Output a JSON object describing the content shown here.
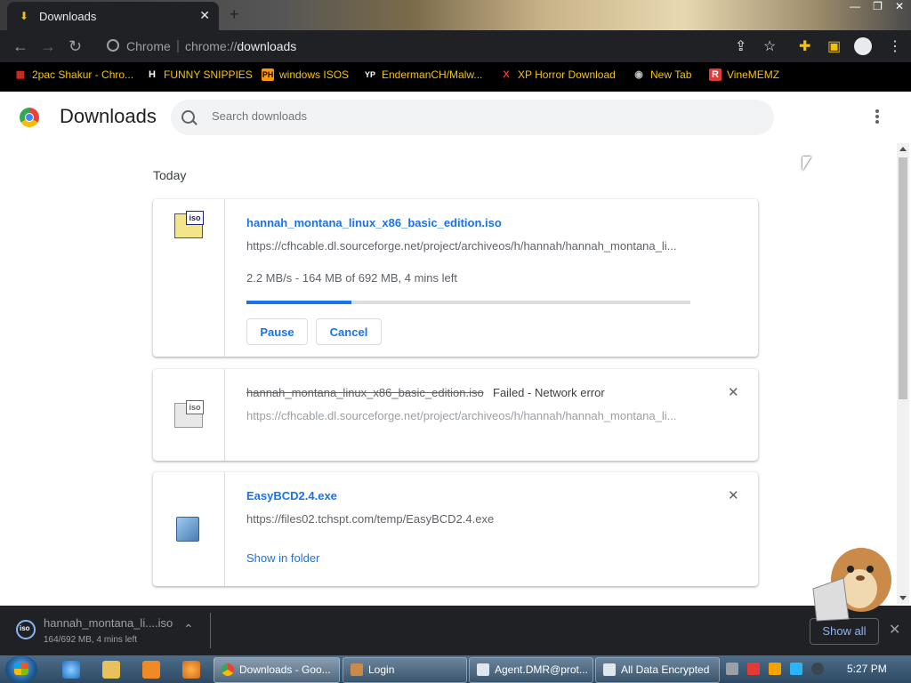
{
  "browser": {
    "tab_title": "Downloads",
    "tab_close": "✕",
    "new_tab": "+",
    "window_controls": [
      "—",
      "❐",
      "✕"
    ],
    "omnibox_site": "Chrome",
    "omnibox_url_prefix": "chrome://",
    "omnibox_url_path": "downloads"
  },
  "bookmarks": [
    {
      "label": "2pac Shakur - Chro...",
      "icon": "folder-icon",
      "glyph": "▦",
      "color": "#d93025"
    },
    {
      "label": "FUNNY SNIPPIES",
      "icon": "h-icon",
      "glyph": "H",
      "color": "#ffffff"
    },
    {
      "label": "windows ISOS",
      "icon": "ph-icon",
      "glyph": "PH",
      "color": "#ff9900"
    },
    {
      "label": "EndermanCH/Malw...",
      "icon": "yp-icon",
      "glyph": "YP",
      "color": "#ffffff"
    },
    {
      "label": "XP Horror Download",
      "icon": "x-icon",
      "glyph": "X",
      "color": "#e53935"
    },
    {
      "label": "New Tab",
      "icon": "globe-icon",
      "glyph": "◉",
      "color": "#bdbdbd"
    },
    {
      "label": "VineMEMZ",
      "icon": "r-icon",
      "glyph": "R",
      "color": "#e53935"
    }
  ],
  "page": {
    "title": "Downloads",
    "search_placeholder": "Search downloads",
    "section_date": "Today"
  },
  "downloads": [
    {
      "filename": "hannah_montana_linux_x86_basic_edition.iso",
      "url": "https://cfhcable.dl.sourceforge.net/project/archiveos/h/hannah/hannah_montana_li...",
      "status": "2.2 MB/s - 164 MB of 692 MB, 4 mins left",
      "progress_fraction": 0.237,
      "pause_label": "Pause",
      "cancel_label": "Cancel"
    },
    {
      "filename": "hannah_montana_linux_x86_basic_edition.iso",
      "failed_label": "Failed - Network error",
      "url": "https://cfhcable.dl.sourceforge.net/project/archiveos/h/hannah/hannah_montana_li...",
      "remove": "✕"
    },
    {
      "filename": "EasyBCD2.4.exe",
      "url": "https://files02.tchspt.com/temp/EasyBCD2.4.exe",
      "link_label": "Show in folder",
      "remove": "✕"
    }
  ],
  "shelf": {
    "filename": "hannah_montana_li....iso",
    "progress": "164/692 MB, 4 mins left",
    "chevron": "⌃",
    "show_all": "Show all",
    "close": "✕"
  },
  "taskbar": {
    "items": [
      {
        "label": "Downloads - Goo...",
        "icon": "chrome-icon",
        "active": true
      },
      {
        "label": "Login",
        "icon": "app-icon",
        "active": false
      },
      {
        "label": "Agent.DMR@prot...",
        "icon": "window-icon",
        "active": false
      },
      {
        "label": "All Data Encrypted",
        "icon": "window-icon",
        "active": false
      }
    ],
    "clock": "5:27 PM"
  }
}
